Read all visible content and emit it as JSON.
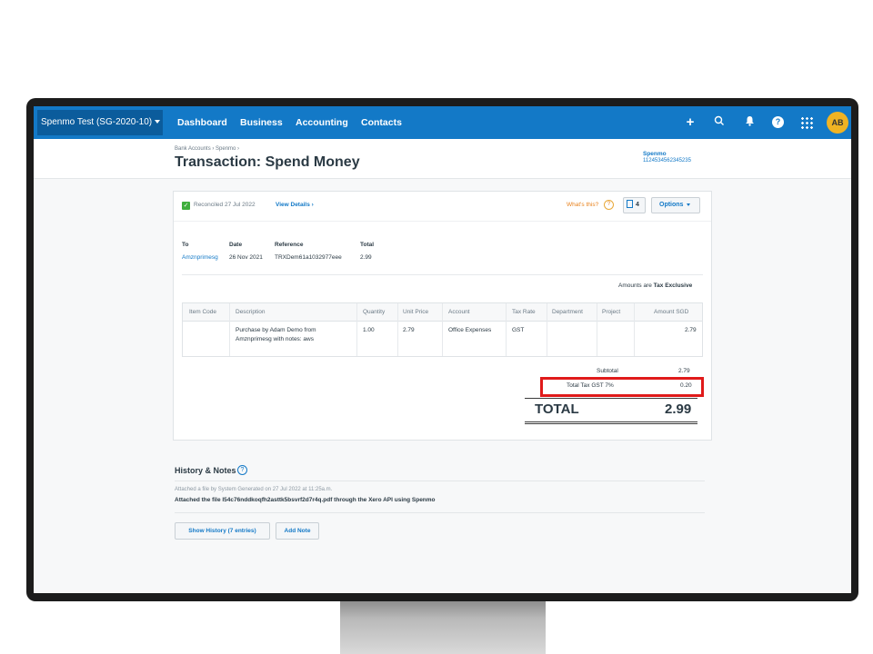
{
  "topbar": {
    "org_name": "Spenmo Test (SG-2020-10)",
    "nav": [
      "Dashboard",
      "Business",
      "Accounting",
      "Contacts"
    ],
    "icons": [
      "plus-icon",
      "search-icon",
      "bell-icon",
      "help-icon",
      "apps-icon"
    ],
    "plus": "+",
    "help": "?",
    "avatar": "AB"
  },
  "header": {
    "breadcrumb": "Bank Accounts › Spenmo ›",
    "title": "Transaction: Spend Money",
    "account_name": "Spenmo",
    "account_number": "1124534562345235"
  },
  "status": {
    "reconciled": "Reconciled 27 Jul 2022",
    "view_details": "View Details ›",
    "whats_this": "What's this?",
    "files_count": "4",
    "options": "Options"
  },
  "details": {
    "to_label": "To",
    "to_value": "Amznprimesg",
    "date_label": "Date",
    "date_value": "26 Nov 2021",
    "reference_label": "Reference",
    "reference_value": "TRXDem61a1032977eee",
    "total_label": "Total",
    "total_value": "2.99"
  },
  "amounts_are": {
    "prefix": "Amounts are",
    "value": "Tax Exclusive"
  },
  "line_items": {
    "columns": [
      "Item Code",
      "Description",
      "Quantity",
      "Unit Price",
      "Account",
      "Tax Rate",
      "Department",
      "Project",
      "Amount SGD"
    ],
    "rows": [
      {
        "item_code": "",
        "description_line1": "Purchase by Adam Demo from",
        "description_line2": "Amznprimesg with notes: aws",
        "quantity": "1.00",
        "unit_price": "2.79",
        "account": "Office Expenses",
        "tax_rate": "GST",
        "department": "",
        "project": "",
        "amount": "2.79"
      }
    ]
  },
  "totals": {
    "subtotal_label": "Subtotal",
    "subtotal_value": "2.79",
    "tax_label": "Total Tax GST 7%",
    "tax_value": "0.20",
    "total_label": "TOTAL",
    "total_value": "2.99"
  },
  "highlight_color": "#e01a1a",
  "brand_color": "#1379c7",
  "history": {
    "title": "History & Notes",
    "meta": "Attached a file by System Generated on 27 Jul 2022 at 11:25a.m.",
    "note": "Attached the file l54c76nddkoqfh2asttk5bsvrf2d7r4q.pdf through the Xero API using Spenmo",
    "show_history": "Show History (7 entries)",
    "add_note": "Add Note"
  }
}
